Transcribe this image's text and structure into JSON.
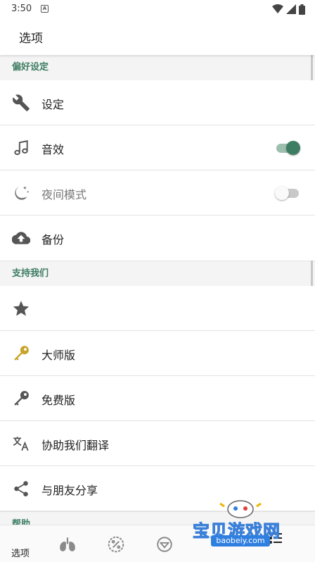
{
  "status_bar": {
    "time": "3:50",
    "notification_letter": "A",
    "icons": [
      "wifi-icon",
      "signal-icon",
      "battery-icon"
    ]
  },
  "app_bar": {
    "title": "选项"
  },
  "sections": [
    {
      "header": "偏好设定",
      "items": [
        {
          "icon": "wrench-icon",
          "label": "设定"
        },
        {
          "icon": "music-note-icon",
          "label": "音效",
          "toggle": true
        },
        {
          "icon": "night-mode-icon",
          "label": "夜间模式",
          "toggle": false
        },
        {
          "icon": "cloud-upload-icon",
          "label": "备份"
        }
      ]
    },
    {
      "header": "支持我们",
      "items": [
        {
          "icon": "star-icon",
          "label": ""
        },
        {
          "icon": "gold-key-icon",
          "label": "大师版"
        },
        {
          "icon": "key-icon",
          "label": "免费版"
        },
        {
          "icon": "translate-icon",
          "label": "协助我们翻译"
        },
        {
          "icon": "share-icon",
          "label": "与朋友分享"
        }
      ]
    },
    {
      "header": "帮助",
      "items": []
    }
  ],
  "bottom_nav": {
    "items": [
      {
        "icon": "lungs-icon"
      },
      {
        "icon": "percent-badge-icon"
      },
      {
        "icon": "target-icon"
      },
      {
        "icon": "options-icon",
        "label": "选项",
        "active": true
      }
    ]
  },
  "watermark": {
    "text": "宝贝游戏网",
    "url": "baobeiy.com"
  },
  "colors": {
    "accent": "#3d7d62",
    "accent_light": "#9cbfae",
    "section_bg": "#f4f4f4",
    "divider": "#e3e3e3",
    "gold": "#c9a227"
  }
}
